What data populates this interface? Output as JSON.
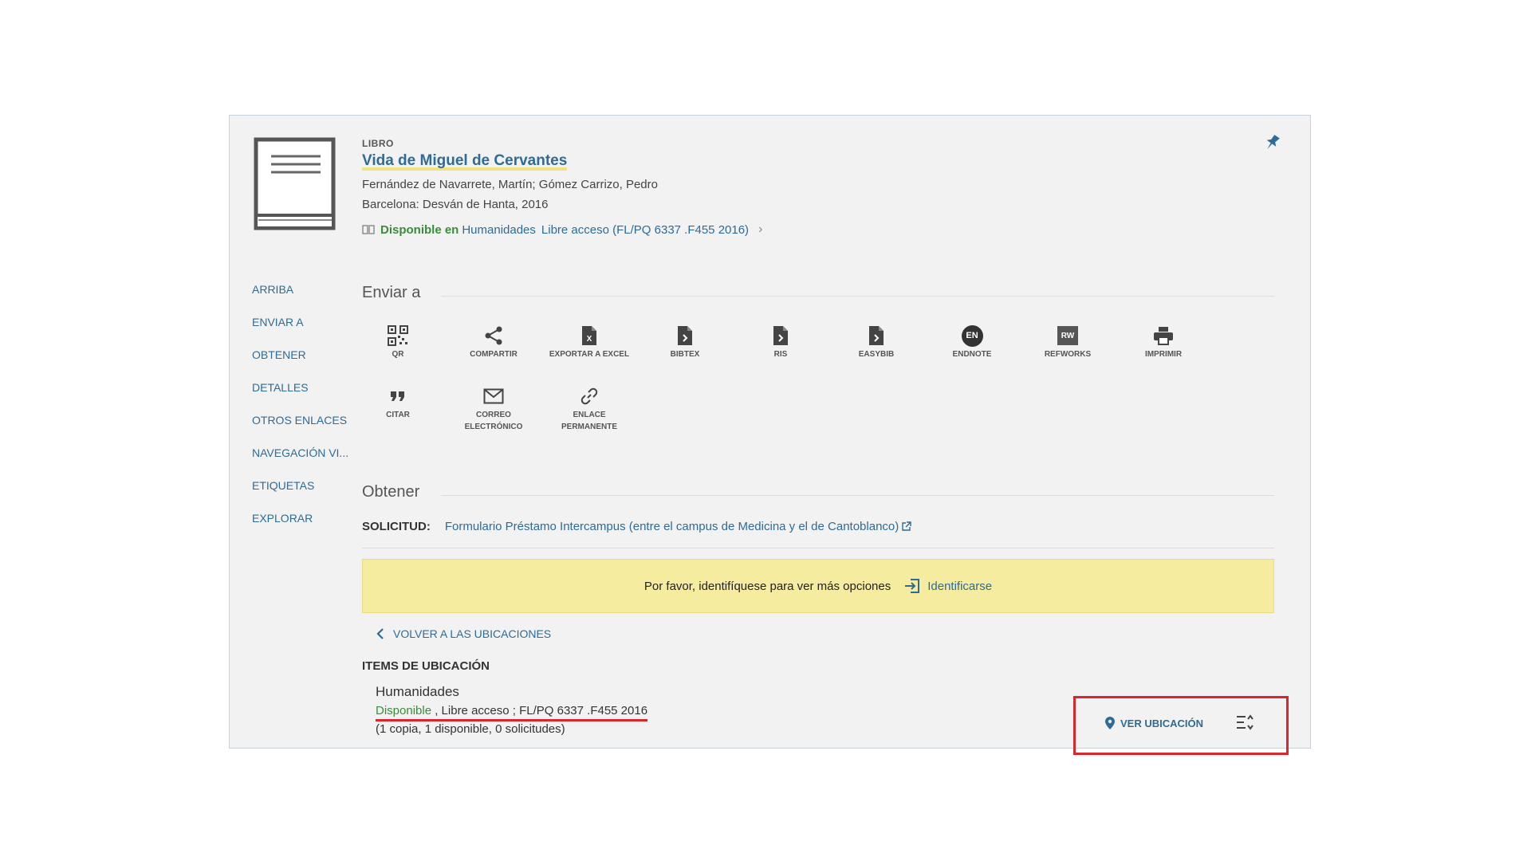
{
  "record": {
    "type": "LIBRO",
    "title": "Vida de Miguel de Cervantes",
    "authors": "Fernández de Navarrete, Martín; Gómez Carrizo, Pedro",
    "publication": "Barcelona: Desván de Hanta, 2016",
    "availability": {
      "status": "Disponible en",
      "library": "Humanidades",
      "location": "Libre acceso (FL/PQ 6337 .F455 2016)"
    }
  },
  "nav": {
    "items": [
      "ARRIBA",
      "ENVIAR A",
      "OBTENER",
      "DETALLES",
      "OTROS ENLACES",
      "NAVEGACIÓN VI...",
      "ETIQUETAS",
      "EXPLORAR"
    ]
  },
  "send_to": {
    "title": "Enviar a",
    "actions": [
      {
        "icon": "qr-icon",
        "label": "QR"
      },
      {
        "icon": "share-icon",
        "label": "COMPARTIR"
      },
      {
        "icon": "excel-icon",
        "label": "EXPORTAR A EXCEL"
      },
      {
        "icon": "bibtex-icon",
        "label": "BIBTEX"
      },
      {
        "icon": "ris-icon",
        "label": "RIS"
      },
      {
        "icon": "easybib-icon",
        "label": "EASYBIB"
      },
      {
        "icon": "endnote-icon",
        "label": "ENDNOTE",
        "badge": "EN"
      },
      {
        "icon": "refworks-icon",
        "label": "REFWORKS",
        "badge": "RW"
      },
      {
        "icon": "print-icon",
        "label": "IMPRIMIR"
      },
      {
        "icon": "quote-icon",
        "label": "CITAR"
      },
      {
        "icon": "mail-icon",
        "label": "CORREO ELECTRÓNICO"
      },
      {
        "icon": "link-icon",
        "label": "ENLACE PERMANENTE"
      }
    ]
  },
  "obtain": {
    "title": "Obtener",
    "request_label": "SOLICITUD:",
    "request_link": "Formulario Préstamo Intercampus (entre el campus de Medicina y el de Cantoblanco)",
    "login_message": "Por favor, identifíquese para ver más opciones",
    "login_link": "Identificarse",
    "back_link": "VOLVER A LAS UBICACIONES",
    "items_title": "ITEMS DE UBICACIÓN",
    "location": {
      "name": "Humanidades",
      "status": "Disponible",
      "details": " , Libre acceso ; FL/PQ 6337 .F455 2016",
      "copies": "(1 copia, 1 disponible, 0 solicitudes)"
    },
    "view_location": "VER UBICACIÓN"
  },
  "colors": {
    "link": "#2e6b96",
    "available": "#3a8c3a",
    "highlight": "#d9272e",
    "notice": "#f6ec9f"
  }
}
